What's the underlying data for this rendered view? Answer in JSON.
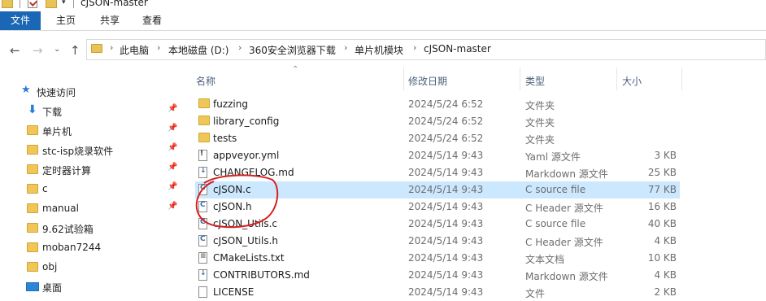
{
  "window": {
    "title": "cJSON-master"
  },
  "ribbon": {
    "tabs": [
      "文件",
      "主页",
      "共享",
      "查看"
    ]
  },
  "address": {
    "crumbs": [
      "此电脑",
      "本地磁盘 (D:)",
      "360安全浏览器下载",
      "单片机模块",
      "cJSON-master"
    ]
  },
  "nav": {
    "quick_access": "快速访问",
    "items": [
      {
        "label": "下载",
        "pinned": true
      },
      {
        "label": "单片机",
        "pinned": true
      },
      {
        "label": "stc-isp烧录软件",
        "pinned": true
      },
      {
        "label": "定时器计算",
        "pinned": true
      },
      {
        "label": "c",
        "pinned": true
      },
      {
        "label": "manual",
        "pinned": true
      },
      {
        "label": "9.62试验箱",
        "pinned": false
      },
      {
        "label": "moban7244",
        "pinned": false
      },
      {
        "label": "obj",
        "pinned": false
      },
      {
        "label": "桌面",
        "pinned": false
      }
    ]
  },
  "columns": {
    "name": "名称",
    "date": "修改日期",
    "type": "类型",
    "size": "大小"
  },
  "files": [
    {
      "name": "fuzzing",
      "date": "2024/5/24 6:52",
      "type": "文件夹",
      "size": "",
      "icon": "folder"
    },
    {
      "name": "library_config",
      "date": "2024/5/24 6:52",
      "type": "文件夹",
      "size": "",
      "icon": "folder"
    },
    {
      "name": "tests",
      "date": "2024/5/24 6:52",
      "type": "文件夹",
      "size": "",
      "icon": "folder"
    },
    {
      "name": "appveyor.yml",
      "date": "2024/5/14 9:43",
      "type": "Yaml 源文件",
      "size": "3 KB",
      "icon": "yml"
    },
    {
      "name": "CHANGELOG.md",
      "date": "2024/5/14 9:43",
      "type": "Markdown 源文件",
      "size": "25 KB",
      "icon": "md"
    },
    {
      "name": "cJSON.c",
      "date": "2024/5/14 9:43",
      "type": "C source file",
      "size": "77 KB",
      "icon": "c",
      "selected": true
    },
    {
      "name": "cJSON.h",
      "date": "2024/5/14 9:43",
      "type": "C Header 源文件",
      "size": "16 KB",
      "icon": "c"
    },
    {
      "name": "cJSON_Utils.c",
      "date": "2024/5/14 9:43",
      "type": "C source file",
      "size": "40 KB",
      "icon": "c"
    },
    {
      "name": "cJSON_Utils.h",
      "date": "2024/5/14 9:43",
      "type": "C Header 源文件",
      "size": "4 KB",
      "icon": "c"
    },
    {
      "name": "CMakeLists.txt",
      "date": "2024/5/14 9:43",
      "type": "文本文档",
      "size": "10 KB",
      "icon": "txt"
    },
    {
      "name": "CONTRIBUTORS.md",
      "date": "2024/5/14 9:43",
      "type": "Markdown 源文件",
      "size": "4 KB",
      "icon": "md"
    },
    {
      "name": "LICENSE",
      "date": "2024/5/14 9:43",
      "type": "文件",
      "size": "2 KB",
      "icon": "txt"
    }
  ],
  "colors": {
    "accent": "#1a67b5",
    "selection": "#cce8ff",
    "annotation": "#d62020",
    "folder": "#f0c657"
  }
}
